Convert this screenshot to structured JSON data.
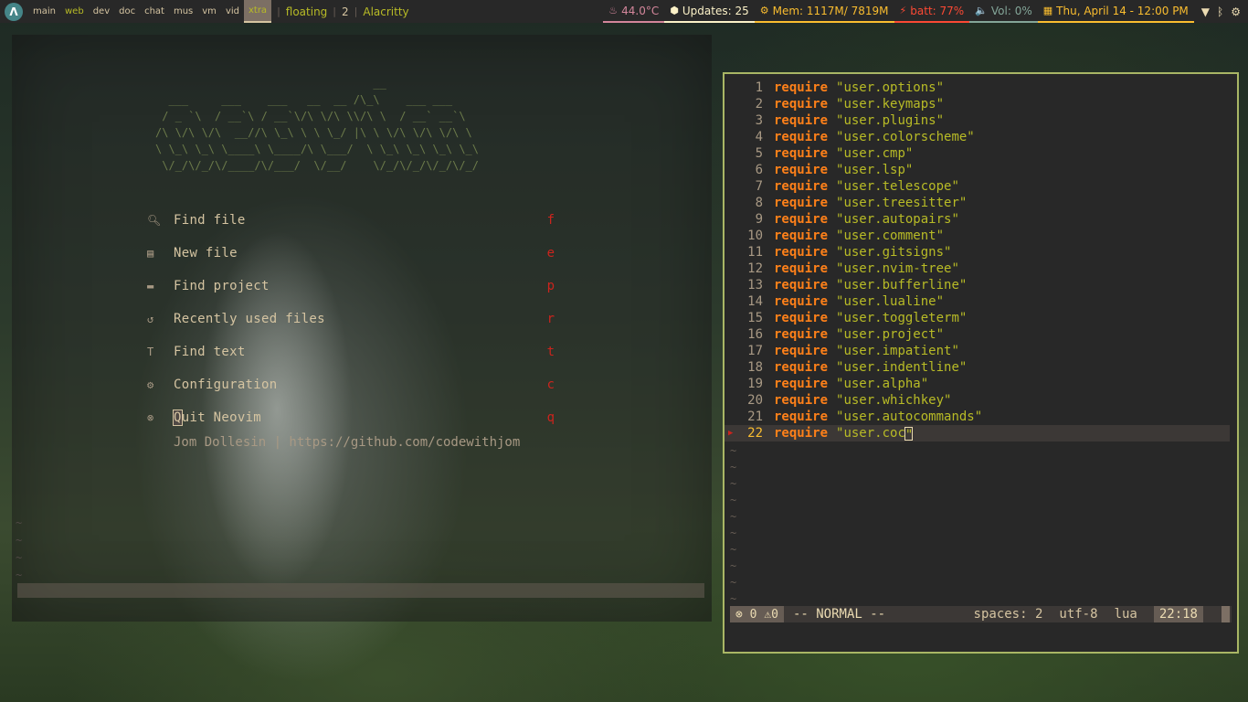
{
  "topbar": {
    "logo_icon": "arch-logo-icon",
    "workspaces": [
      {
        "label": "main",
        "state": "normal"
      },
      {
        "label": "web",
        "state": "occupied"
      },
      {
        "label": "dev",
        "state": "normal"
      },
      {
        "label": "doc",
        "state": "normal"
      },
      {
        "label": "chat",
        "state": "normal"
      },
      {
        "label": "mus",
        "state": "normal"
      },
      {
        "label": "vm",
        "state": "normal"
      },
      {
        "label": "vid",
        "state": "normal"
      },
      {
        "label": "xtra",
        "state": "active"
      }
    ],
    "layout": "floating",
    "window_count": "2",
    "window_title": "Alacritty",
    "cpu_temp": "44.0°C",
    "updates": "Updates: 25",
    "memory": "Mem:  1117M/ 7819M",
    "battery": "batt: 77%",
    "volume": "Vol: 0%",
    "clock": "Thu, April 14 - 12:00 PM"
  },
  "dashboard": {
    "banner_lines": [
      "                                 __",
      "  ___     ___    ___   __  __ /\\_\\    ___ ___",
      " / _ `\\  / __`\\ / __`\\/\\ \\/\\ \\\\/\\ \\  / __` __`\\",
      "/\\ \\/\\ \\/\\  __//\\ \\_\\ \\ \\ \\_/ |\\ \\ \\/\\ \\/\\ \\/\\ \\",
      "\\ \\_\\ \\_\\ \\____\\ \\____/\\ \\___/  \\ \\_\\ \\_\\ \\_\\ \\_\\",
      " \\/_/\\/_/\\/____/\\/___/  \\/__/    \\/_/\\/_/\\/_/\\/_/"
    ],
    "menu": [
      {
        "icon": "file-search-icon",
        "label": "Find file",
        "key": "f"
      },
      {
        "icon": "new-file-icon",
        "label": "New file",
        "key": "e"
      },
      {
        "icon": "folder-icon",
        "label": "Find project",
        "key": "p"
      },
      {
        "icon": "history-icon",
        "label": "Recently used files",
        "key": "r"
      },
      {
        "icon": "text-icon",
        "label": "Find text",
        "key": "t"
      },
      {
        "icon": "gear-icon",
        "label": "Configuration",
        "key": "c"
      },
      {
        "icon": "quit-icon",
        "label_first": "Q",
        "label_rest": "uit Neovim",
        "key": "q"
      }
    ],
    "footer": "Jom Dollesin | https://github.com/codewithjom"
  },
  "editor": {
    "keyword": "require",
    "lines": [
      {
        "num": "1",
        "module": "\"user.options\""
      },
      {
        "num": "2",
        "module": "\"user.keymaps\""
      },
      {
        "num": "3",
        "module": "\"user.plugins\""
      },
      {
        "num": "4",
        "module": "\"user.colorscheme\""
      },
      {
        "num": "5",
        "module": "\"user.cmp\""
      },
      {
        "num": "6",
        "module": "\"user.lsp\""
      },
      {
        "num": "7",
        "module": "\"user.telescope\""
      },
      {
        "num": "8",
        "module": "\"user.treesitter\""
      },
      {
        "num": "9",
        "module": "\"user.autopairs\""
      },
      {
        "num": "10",
        "module": "\"user.comment\""
      },
      {
        "num": "11",
        "module": "\"user.gitsigns\""
      },
      {
        "num": "12",
        "module": "\"user.nvim-tree\""
      },
      {
        "num": "13",
        "module": "\"user.bufferline\""
      },
      {
        "num": "14",
        "module": "\"user.lualine\""
      },
      {
        "num": "15",
        "module": "\"user.toggleterm\""
      },
      {
        "num": "16",
        "module": "\"user.project\""
      },
      {
        "num": "17",
        "module": "\"user.impatient\""
      },
      {
        "num": "18",
        "module": "\"user.indentline\""
      },
      {
        "num": "19",
        "module": "\"user.alpha\""
      },
      {
        "num": "20",
        "module": "\"user.whichkey\""
      },
      {
        "num": "21",
        "module": "\"user.autocommands\""
      }
    ],
    "current_line": {
      "num": "22",
      "module": "\"user.coc",
      "tail": "\"",
      "sign": "▶"
    },
    "status": {
      "errors": "0",
      "warnings": "0",
      "mode": "-- NORMAL --",
      "indent": "spaces: 2",
      "encoding": "utf-8",
      "filetype": "lua",
      "position": "22:18"
    }
  },
  "colors": {
    "accent": "#b8bb26",
    "keyword": "#fe8019",
    "border": "#a9b665",
    "danger": "#cc241d"
  }
}
